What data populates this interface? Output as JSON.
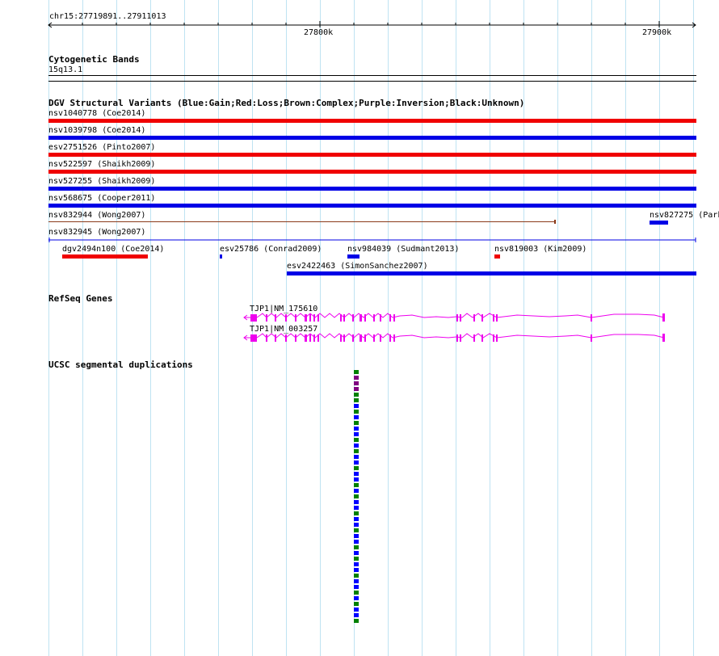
{
  "ruler": {
    "region": "chr15:27719891..27911013",
    "ticks": [
      {
        "label": "27800k"
      },
      {
        "label": "27900k"
      }
    ]
  },
  "cytoband": {
    "title": "Cytogenetic Bands",
    "band": "15q13.1"
  },
  "dgv": {
    "title": "DGV Structural Variants (Blue:Gain;Red:Loss;Brown:Complex;Purple:Inversion;Black:Unknown)",
    "colors": {
      "gain": "#0000e6",
      "loss": "#f00000",
      "brown": "#8b3a1a"
    },
    "items": [
      {
        "label": "nsv1040778 (Coe2014)",
        "type": "loss"
      },
      {
        "label": "nsv1039798 (Coe2014)",
        "type": "gain"
      },
      {
        "label": "esv2751526 (Pinto2007)",
        "type": "loss"
      },
      {
        "label": "nsv522597 (Shaikh2009)",
        "type": "loss"
      },
      {
        "label": "nsv527255 (Shaikh2009)",
        "type": "gain"
      },
      {
        "label": "nsv568675 (Cooper2011)",
        "type": "gain"
      },
      {
        "label": "nsv832944 (Wong2007)",
        "type": "complex"
      },
      {
        "label": "nsv827275 (Park",
        "type": "gain"
      },
      {
        "label": "nsv832945 (Wong2007)",
        "type": "gain"
      },
      {
        "label": "dgv2494n100 (Coe2014)",
        "type": "loss"
      },
      {
        "label": "esv25786 (Conrad2009)",
        "type": "gain"
      },
      {
        "label": "nsv984039 (Sudmant2013)",
        "type": "gain"
      },
      {
        "label": "nsv819003 (Kim2009)",
        "type": "loss"
      },
      {
        "label": "esv2422463 (SimonSanchez2007)",
        "type": "gain"
      }
    ]
  },
  "refseq": {
    "title": "RefSeq Genes",
    "color": "#ee00ee",
    "transcripts": [
      {
        "label": "TJP1|NM_175610"
      },
      {
        "label": "TJP1|NM_003257"
      }
    ]
  },
  "segdups": {
    "title": "UCSC segmental duplications",
    "colors": [
      "#008000",
      "#800080",
      "#800080",
      "#800080",
      "#008000",
      "#008000",
      "#0000ff",
      "#008000",
      "#0000ff",
      "#008000",
      "#0000ff",
      "#0000ff",
      "#008000",
      "#0000ff",
      "#008000",
      "#0000ff",
      "#0000ff",
      "#008000",
      "#0000ff",
      "#0000ff",
      "#008000",
      "#0000ff",
      "#008000",
      "#0000ff",
      "#0000ff",
      "#008000",
      "#0000ff",
      "#0000ff",
      "#008000",
      "#0000ff",
      "#0000ff",
      "#008000",
      "#0000ff",
      "#008000",
      "#0000ff",
      "#0000ff",
      "#008000",
      "#0000ff",
      "#0000ff",
      "#008000",
      "#0000ff",
      "#008000",
      "#0000ff",
      "#0000ff",
      "#008000"
    ]
  }
}
